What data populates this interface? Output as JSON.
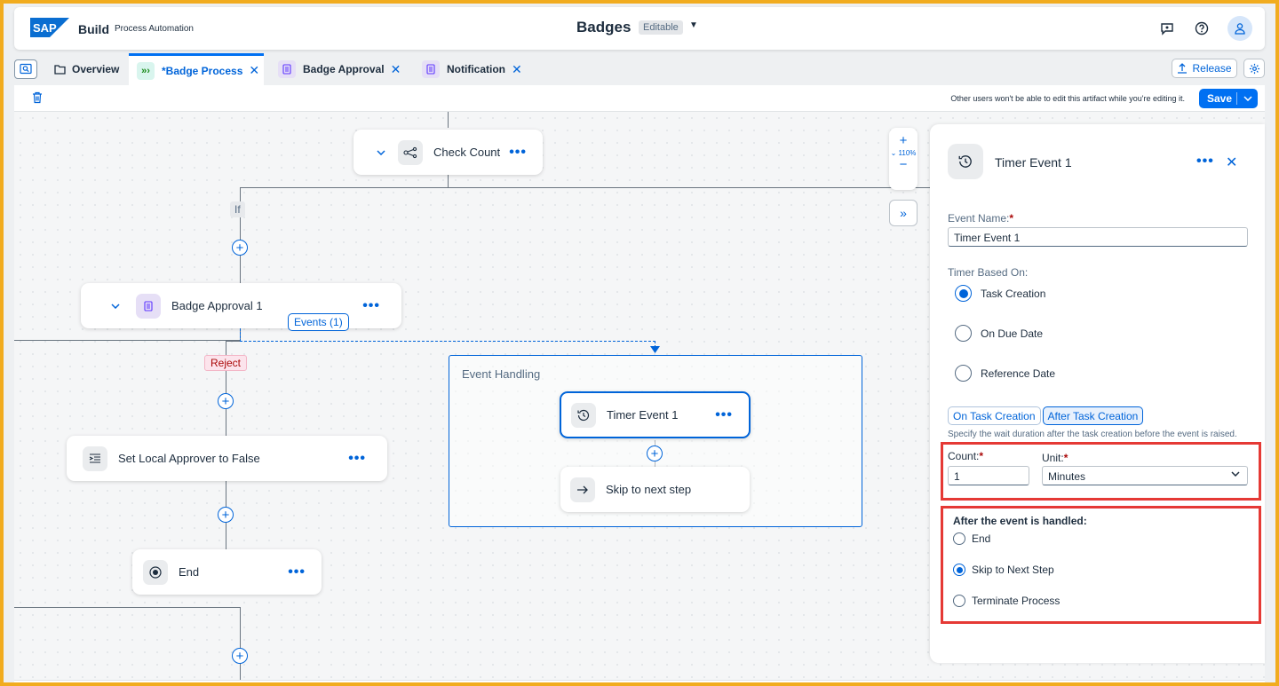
{
  "shell": {
    "brand": "Build",
    "brand_sub": "Process Automation",
    "title": "Badges",
    "editable": "Editable",
    "logo_text": "SAP"
  },
  "tabs": [
    {
      "label": "Overview",
      "icon": "folder-icon"
    },
    {
      "label": "*Badge Process",
      "icon": "process-icon",
      "active": true
    },
    {
      "label": "Badge Approval",
      "icon": "form-icon"
    },
    {
      "label": "Notification",
      "icon": "form-icon"
    }
  ],
  "tab_close": "✕",
  "release_label": "Release",
  "toolbar": {
    "message": "Other users won't be able to edit this artifact while you're editing it.",
    "save_label": "Save"
  },
  "canvas": {
    "check_count": "Check Count",
    "if_label": "If",
    "badge_approval": "Badge Approval 1",
    "events_label": "Events (1)",
    "reject_label": "Reject",
    "set_local": "Set Local Approver to False",
    "end": "End",
    "event_handling": "Event Handling",
    "timer_event": "Timer Event 1",
    "skip_next": "Skip to next step",
    "zoom_level": "110%",
    "dots": "•••"
  },
  "panel": {
    "title": "Timer Event 1",
    "event_name_label": "Event Name:",
    "event_name_value": "Timer Event 1",
    "timer_based_label": "Timer Based On:",
    "timer_options": [
      "Task Creation",
      "On Due Date",
      "Reference Date"
    ],
    "timer_selected": 0,
    "segment": [
      "On Task Creation",
      "After Task Creation"
    ],
    "segment_selected": 1,
    "hint": "Specify the wait duration after the task creation before the event is raised.",
    "count_label": "Count:",
    "count_value": "1",
    "unit_label": "Unit:",
    "unit_value": "Minutes",
    "after_title": "After the event is handled:",
    "after_options": [
      "End",
      "Skip to Next Step",
      "Terminate Process"
    ],
    "after_selected": 1,
    "required_mark": "*"
  },
  "colors": {
    "accent": "#0070f2",
    "highlight": "#e53935",
    "border_frame": "#f1ac1f"
  }
}
